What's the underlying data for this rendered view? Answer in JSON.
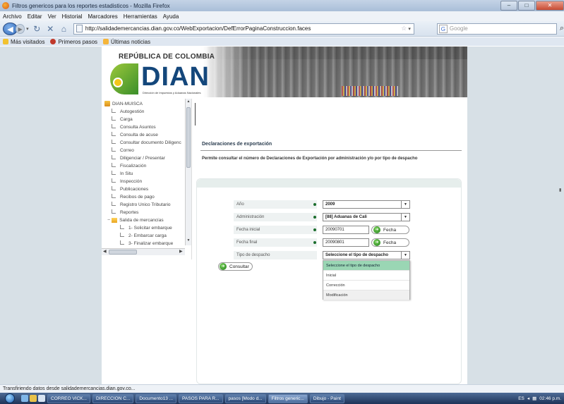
{
  "window": {
    "title": "Filtros genericos para los reportes estadisticos - Mozilla Firefox"
  },
  "menu": [
    "Archivo",
    "Editar",
    "Ver",
    "Historial",
    "Marcadores",
    "Herramientas",
    "Ayuda"
  ],
  "nav": {
    "url": "http://salidademercancias.dian.gov.co/WebExportacion/DefErrorPaginaConstruccion.faces",
    "search_placeholder": "Google"
  },
  "bookmarks": [
    {
      "label": "Más visitados",
      "color": "#f2c230"
    },
    {
      "label": "Primeros pasos",
      "color": "#c0392b"
    },
    {
      "label": "Últimas noticias",
      "color": "#f5b53a"
    }
  ],
  "banner": {
    "republic": "REPÚBLICA DE COLOMBIA",
    "logo_text": "DIAN",
    "logo_sub": "Dirección de Impuestos y Aduanas Nacionales"
  },
  "tree": {
    "root": "DIAN-MUISCA",
    "items": [
      "Autogestión",
      "Carga",
      "Consulta Asuntos",
      "Consulta de acuse",
      "Consultar documento Diligenc",
      "Correo",
      "Diligenciar / Presentar",
      "Fiscalización",
      "In Situ",
      "Inspección",
      "Publicaciones",
      "Recibos de pago",
      "Registro Unico Tributario",
      "Reportes"
    ],
    "folder": "Salida de mercancías",
    "subitems": [
      "1- Solicitar embarque",
      "2- Embarcar carga",
      "3- Finalizar embarque"
    ]
  },
  "main": {
    "title": "Declaraciones de exportación",
    "description": "Permite consultar el número de Declaraciones de Exportación por administración y/o por tipo de despacho"
  },
  "form": {
    "anio_label": "Año",
    "anio_value": "2009",
    "admin_label": "Administración",
    "admin_value": "[88]  Aduanas de Cali",
    "fecha_inicial_label": "Fecha inicial",
    "fecha_inicial_value": "20090701",
    "fecha_final_label": "Fecha final",
    "fecha_final_value": "20090801",
    "fecha_button": "Fecha",
    "tipo_label": "Tipo de despacho",
    "tipo_value": "Seleccione el tipo de despacho",
    "tipo_options": [
      "Seleccione el tipo de despacho",
      "Inicial",
      "Corrección",
      "Modificación"
    ],
    "consultar_label": "Consultar"
  },
  "status": "Transfiriendo datos desde salidademercancias.dian.gov.co...",
  "taskbar": {
    "tasks": [
      "CORREO VICK...",
      "DIRECCION C...",
      "Documento13 ...",
      "PASOS PARA R...",
      "pasos [Modo d...",
      "Filtros generic...",
      "Dibujo - Paint"
    ],
    "active_index": 5,
    "lang": "ES",
    "clock": "02:46 p.m."
  }
}
